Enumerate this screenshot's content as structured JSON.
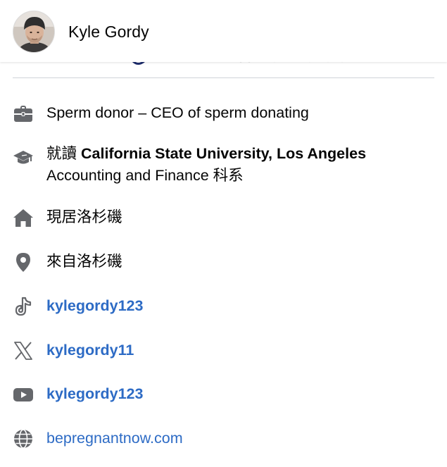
{
  "profile": {
    "name": "Kyle Gordy"
  },
  "colors": {
    "text": "#050505",
    "icon": "#65676b",
    "link": "#2d6bc5",
    "divider": "#cfd3d8"
  },
  "details": {
    "work": {
      "icon": "briefcase-icon",
      "text": "Sperm donor – CEO of sperm donating"
    },
    "education": {
      "icon": "graduation-cap-icon",
      "prefix": "就讀",
      "school": "California State University, Los Angeles",
      "field": "Accounting and Finance 科系"
    },
    "current_city": {
      "icon": "home-icon",
      "text": "現居洛杉磯"
    },
    "hometown": {
      "icon": "location-pin-icon",
      "text": "來自洛杉磯"
    },
    "tiktok": {
      "icon": "tiktok-icon",
      "text": "kylegordy123"
    },
    "x_twitter": {
      "icon": "x-logo-icon",
      "text": "kylegordy11"
    },
    "youtube": {
      "icon": "youtube-icon",
      "text": "kylegordy123"
    },
    "website": {
      "icon": "globe-icon",
      "text": "bepregnantnow.com"
    }
  }
}
